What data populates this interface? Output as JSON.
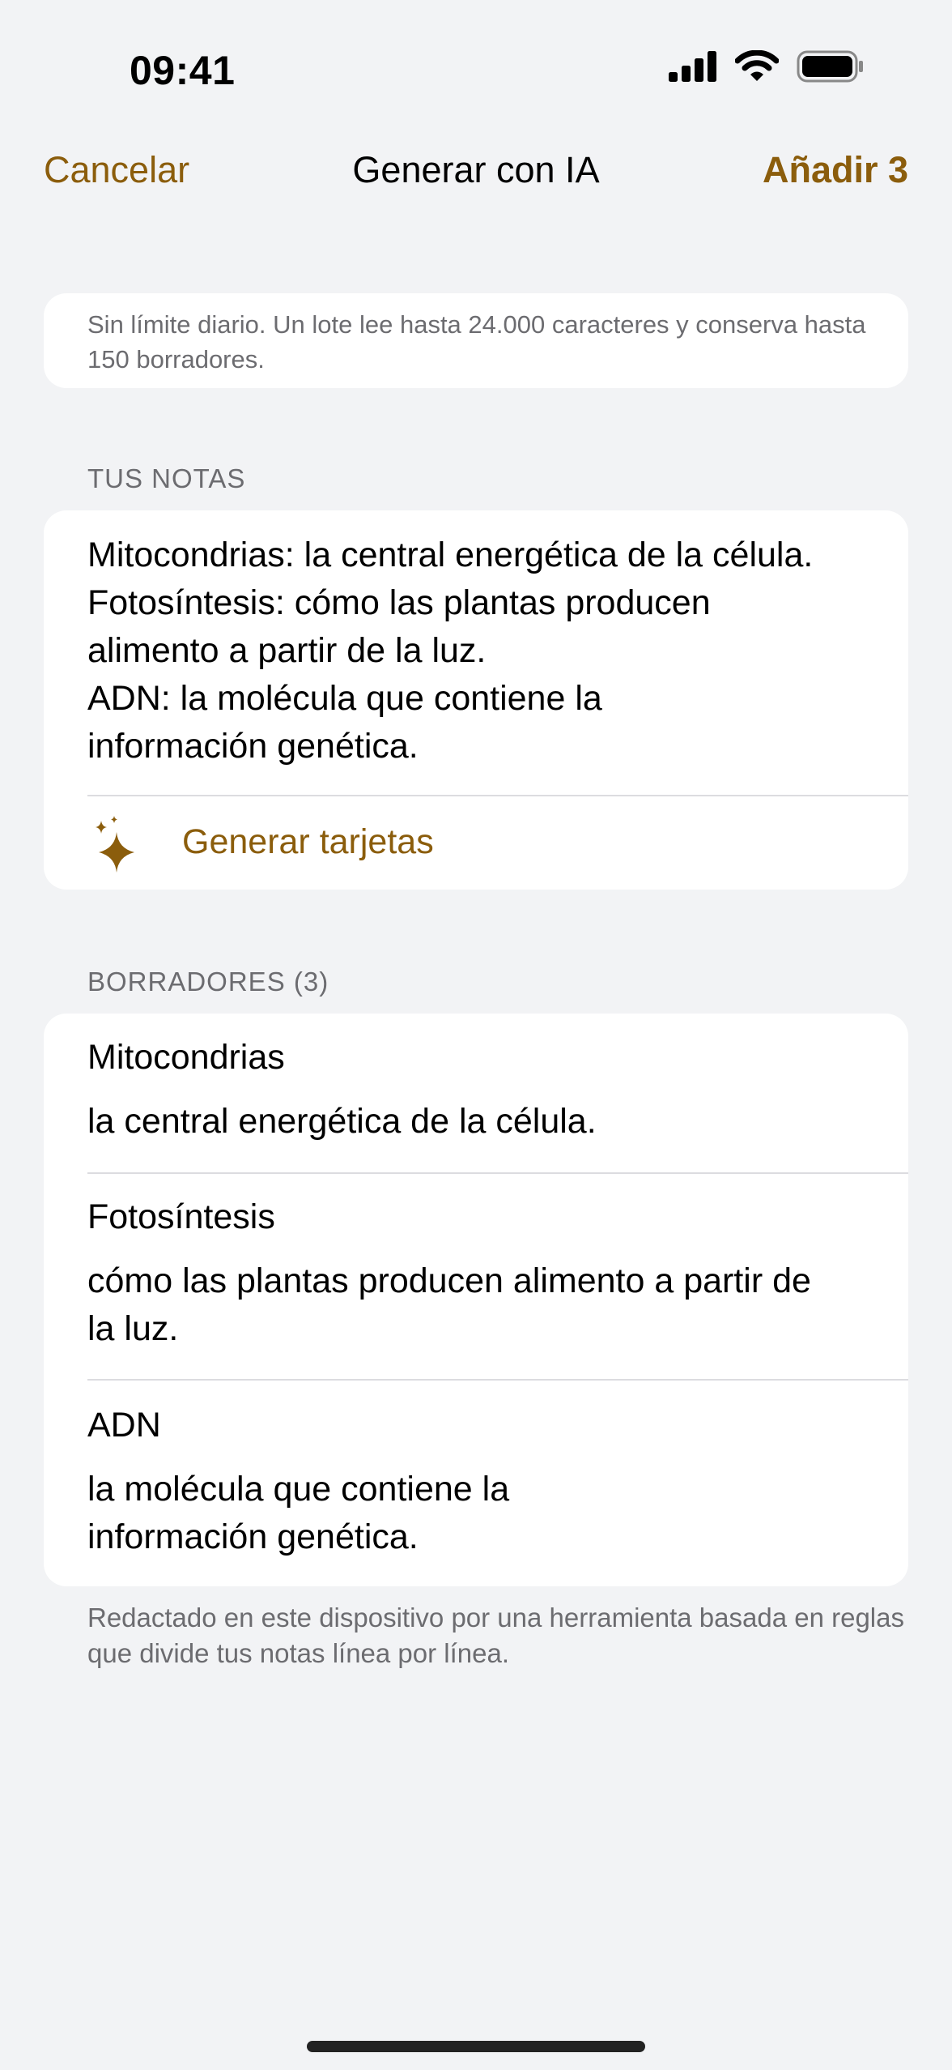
{
  "status_bar": {
    "time": "09:41",
    "icons": [
      "cellular-signal-icon",
      "wifi-icon",
      "battery-icon"
    ]
  },
  "nav": {
    "cancel_label": "Cancelar",
    "title": "Generar con IA",
    "add_label": "Añadir 3"
  },
  "info": {
    "text": "Sin límite diario. Un lote lee hasta 24.000 caracteres y conserva hasta 150 borradores."
  },
  "notes": {
    "header": "TUS NOTAS",
    "text": "Mitocondrias: la central energética de la célula.\nFotosíntesis: cómo las plantas producen\nalimento a partir de la luz.\nADN: la molécula que contiene la\ninformación genética.",
    "generate_label": "Generar tarjetas",
    "generate_icon": "sparkles-icon"
  },
  "drafts": {
    "header": "BORRADORES (3)",
    "items": [
      {
        "title": "Mitocondrias",
        "body": "la central energética de la célula."
      },
      {
        "title": "Fotosíntesis",
        "body": "cómo las plantas producen alimento a partir de\nla luz."
      },
      {
        "title": "ADN",
        "body": "la molécula que contiene la\ninformación genética."
      }
    ]
  },
  "footer": {
    "text": "Redactado en este dispositivo por una herramienta basada en reglas que divide tus notas línea por línea."
  },
  "colors": {
    "accent": "#8b5d0c",
    "background": "#f2f3f5",
    "card": "#ffffff",
    "secondary_text": "#6c6c70"
  }
}
